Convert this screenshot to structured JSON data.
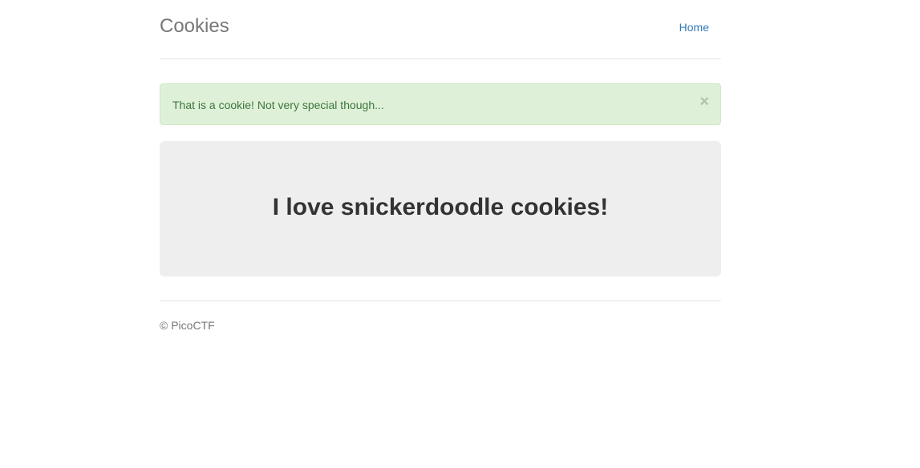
{
  "header": {
    "brand": "Cookies",
    "nav": {
      "home_label": "Home"
    }
  },
  "alert": {
    "message": "That is a cookie! Not very special though...",
    "close_symbol": "×"
  },
  "jumbotron": {
    "heading": "I love snickerdoodle cookies!"
  },
  "footer": {
    "text": "© PicoCTF"
  },
  "colors": {
    "alert_background": "#dff0d8",
    "alert_text": "#3c763d",
    "link": "#337ab7",
    "jumbotron_background": "#eeeeee"
  }
}
